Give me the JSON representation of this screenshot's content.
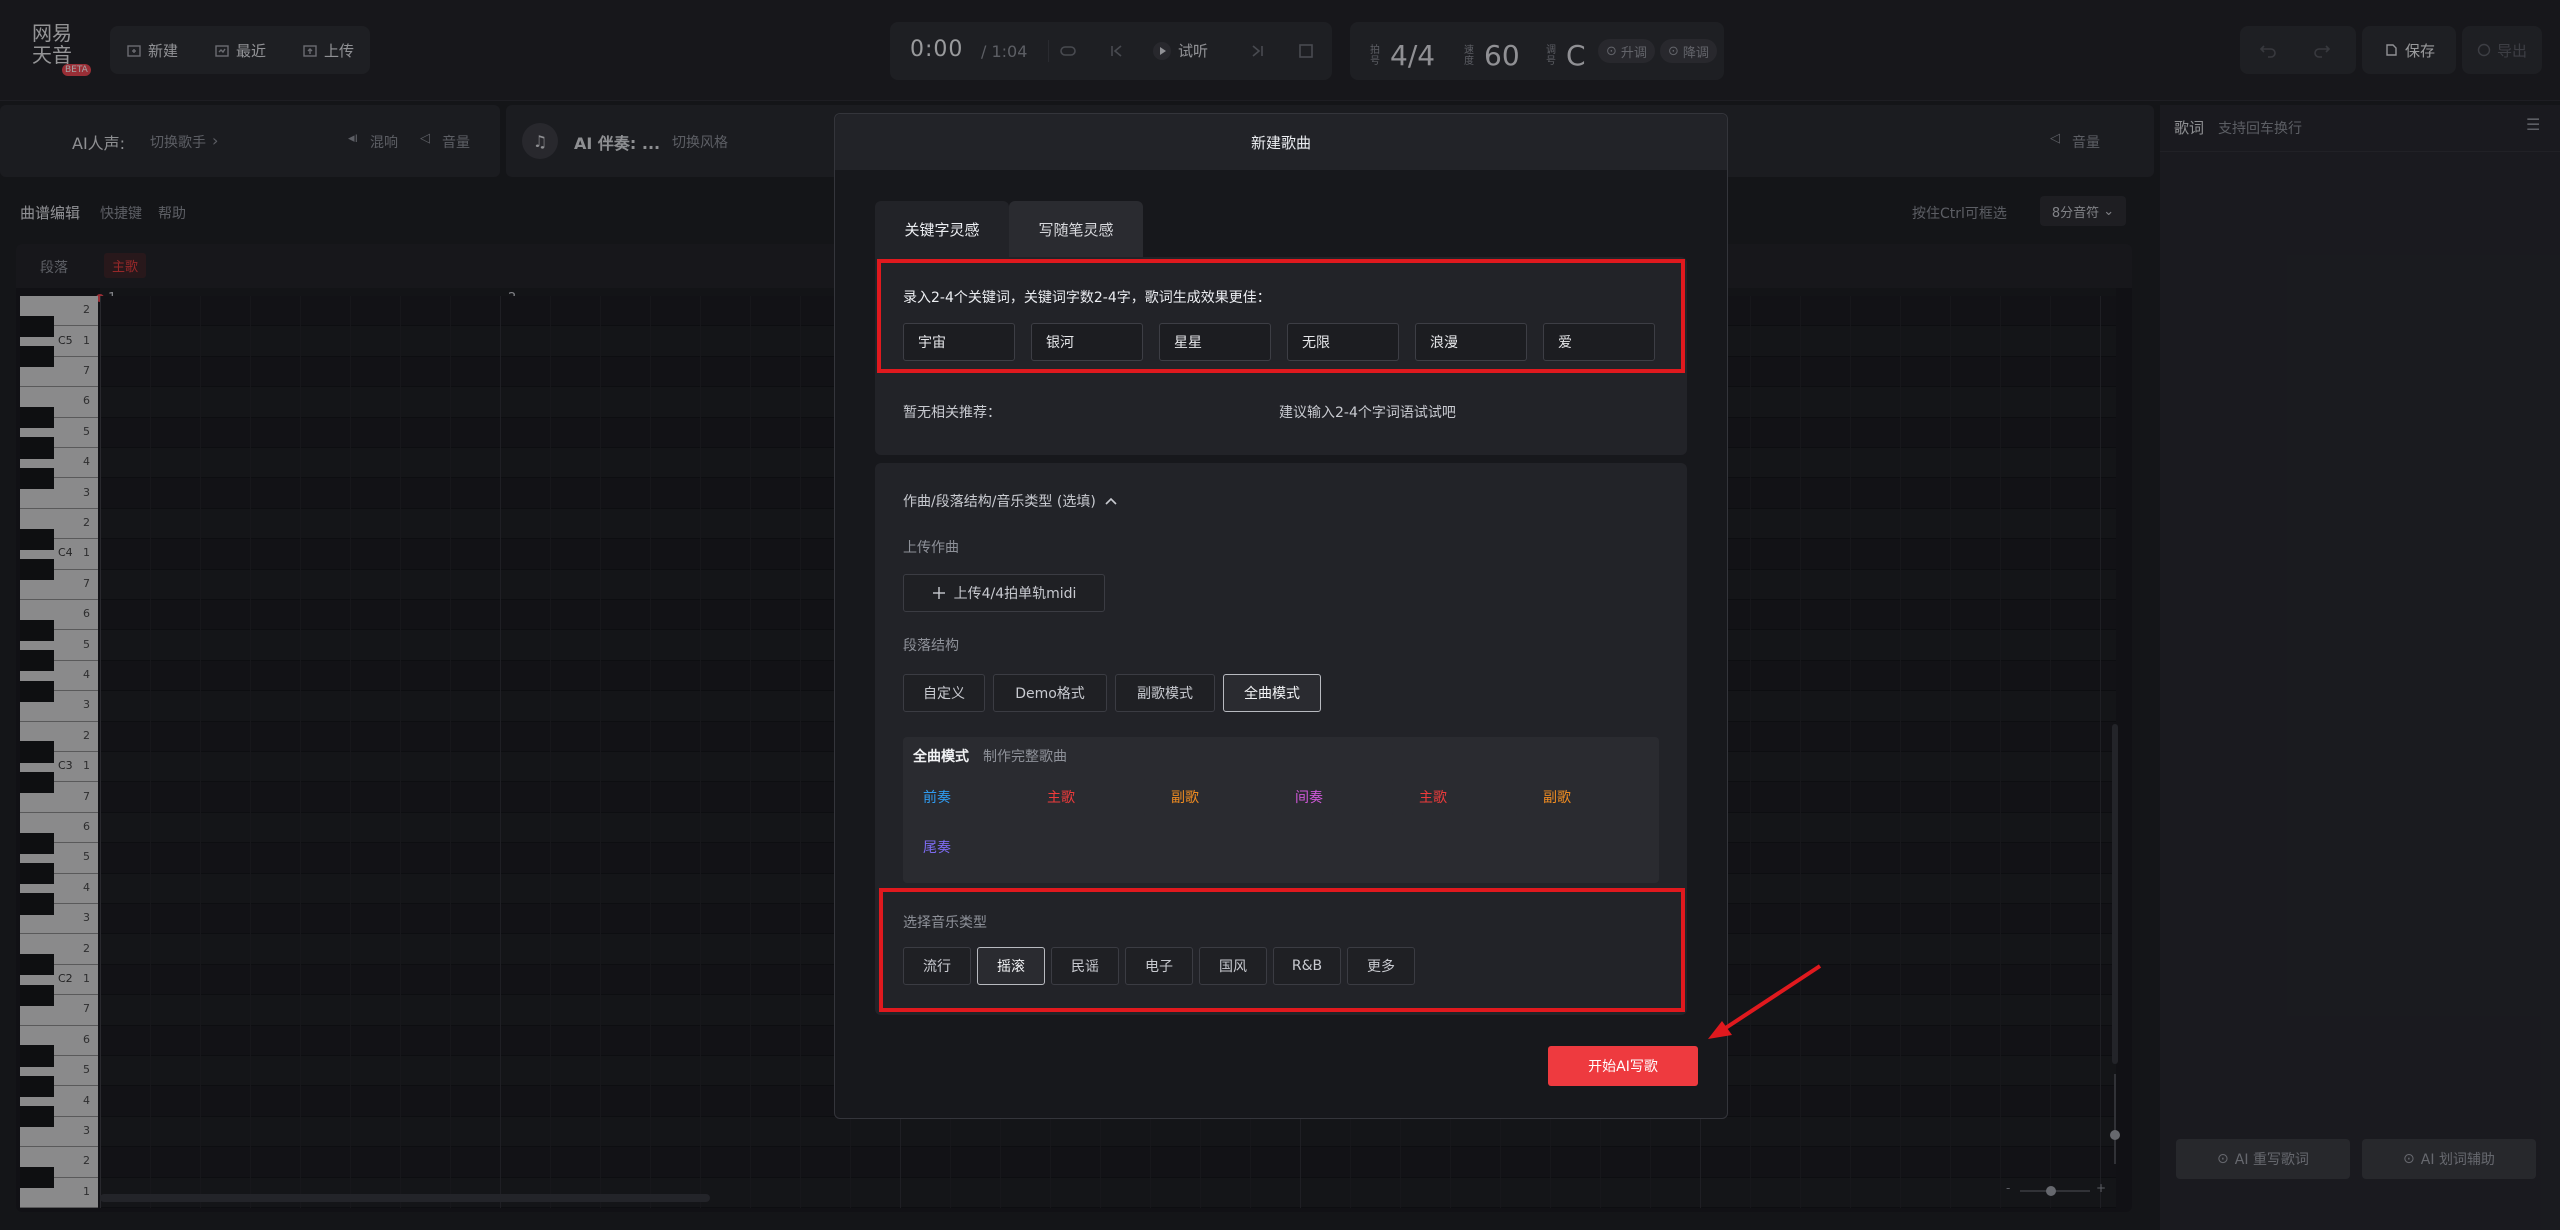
{
  "brand": {
    "logo_line1": "网易",
    "logo_line2": "天音",
    "badge": "BETA"
  },
  "toolbar": {
    "new_label": "新建",
    "recent_label": "最近",
    "upload_label": "上传",
    "time_current": "0:00",
    "time_total": "/ 1:04",
    "preview_label": "试听",
    "meter_lbl_1": "拍号",
    "time_signature": "4/4",
    "meter_lbl_2": "速度",
    "tempo": "60",
    "meter_lbl_3": "调号",
    "key": "C",
    "raise_label": "升调",
    "lower_label": "降调",
    "save_label": "保存",
    "export_label": "导出"
  },
  "vocal_bar": {
    "title": "AI人声:",
    "switch_label": "切换歌手",
    "reverb_label": "混响",
    "volume_label": "音量"
  },
  "acc_bar": {
    "title": "AI 伴奏: ...",
    "switch_label": "切换风格",
    "volume_label": "音量"
  },
  "editor": {
    "title": "曲谱编辑",
    "shortcuts": "快捷键",
    "help": "帮助",
    "hint": "按住Ctrl可框选",
    "note_value": "8分音符",
    "section_label": "段落",
    "section_value": "主歌",
    "bar_numbers": [
      "1",
      "2"
    ],
    "octave_labels": [
      "C5",
      "C4",
      "C3",
      "C2"
    ],
    "row_numbers": [
      "2",
      "1",
      "7",
      "6",
      "5",
      "4",
      "3",
      "2",
      "1",
      "7",
      "6",
      "5",
      "4",
      "3",
      "2",
      "1",
      "7",
      "6",
      "5",
      "4",
      "3",
      "2",
      "1",
      "7",
      "6",
      "5",
      "4",
      "3",
      "2",
      "1"
    ]
  },
  "lyrics": {
    "title": "歌词",
    "hint": "支持回车换行",
    "rewrite_label": "AI 重写歌词",
    "assist_label": "AI 划词辅助"
  },
  "modal": {
    "title": "新建歌曲",
    "tabs": [
      {
        "label": "关键字灵感",
        "active": true
      },
      {
        "label": "写随笔灵感",
        "active": false
      }
    ],
    "keyword_prompt": "录入2-4个关键词，关键词字数2-4字，歌词生成效果更佳：",
    "keywords": [
      "宇宙",
      "银河",
      "星星",
      "无限",
      "浪漫",
      "爱"
    ],
    "no_recommend": "暂无相关推荐：",
    "suggest": "建议输入2-4个字词语试试吧",
    "options_title": "作曲/段落结构/音乐类型 (选填)",
    "upload_title": "上传作曲",
    "upload_button": "上传4/4拍单轨midi",
    "structure_title": "段落结构",
    "structures": [
      {
        "label": "自定义",
        "selected": false
      },
      {
        "label": "Demo格式",
        "selected": false
      },
      {
        "label": "副歌模式",
        "selected": false
      },
      {
        "label": "全曲模式",
        "selected": true
      }
    ],
    "mode_name": "全曲模式",
    "mode_desc": "制作完整歌曲",
    "sections": [
      {
        "label": "前奏",
        "color": "#2f9bf0"
      },
      {
        "label": "主歌",
        "color": "#ee3b3b"
      },
      {
        "label": "副歌",
        "color": "#f08c21"
      },
      {
        "label": "间奏",
        "color": "#cf58d8"
      },
      {
        "label": "主歌",
        "color": "#ee3b3b"
      },
      {
        "label": "副歌",
        "color": "#f08c21"
      },
      {
        "label": "尾奏",
        "color": "#7d6cf2"
      }
    ],
    "genre_title": "选择音乐类型",
    "genres": [
      {
        "label": "流行",
        "selected": false
      },
      {
        "label": "摇滚",
        "selected": true
      },
      {
        "label": "民谣",
        "selected": false
      },
      {
        "label": "电子",
        "selected": false
      },
      {
        "label": "国风",
        "selected": false
      },
      {
        "label": "R&B",
        "selected": false
      },
      {
        "label": "更多",
        "selected": false
      }
    ],
    "start_button": "开始AI写歌"
  },
  "colors": {
    "accent": "#f0454f",
    "highlight_box": "#e0191e",
    "primary_button": "#ee3a3f"
  }
}
